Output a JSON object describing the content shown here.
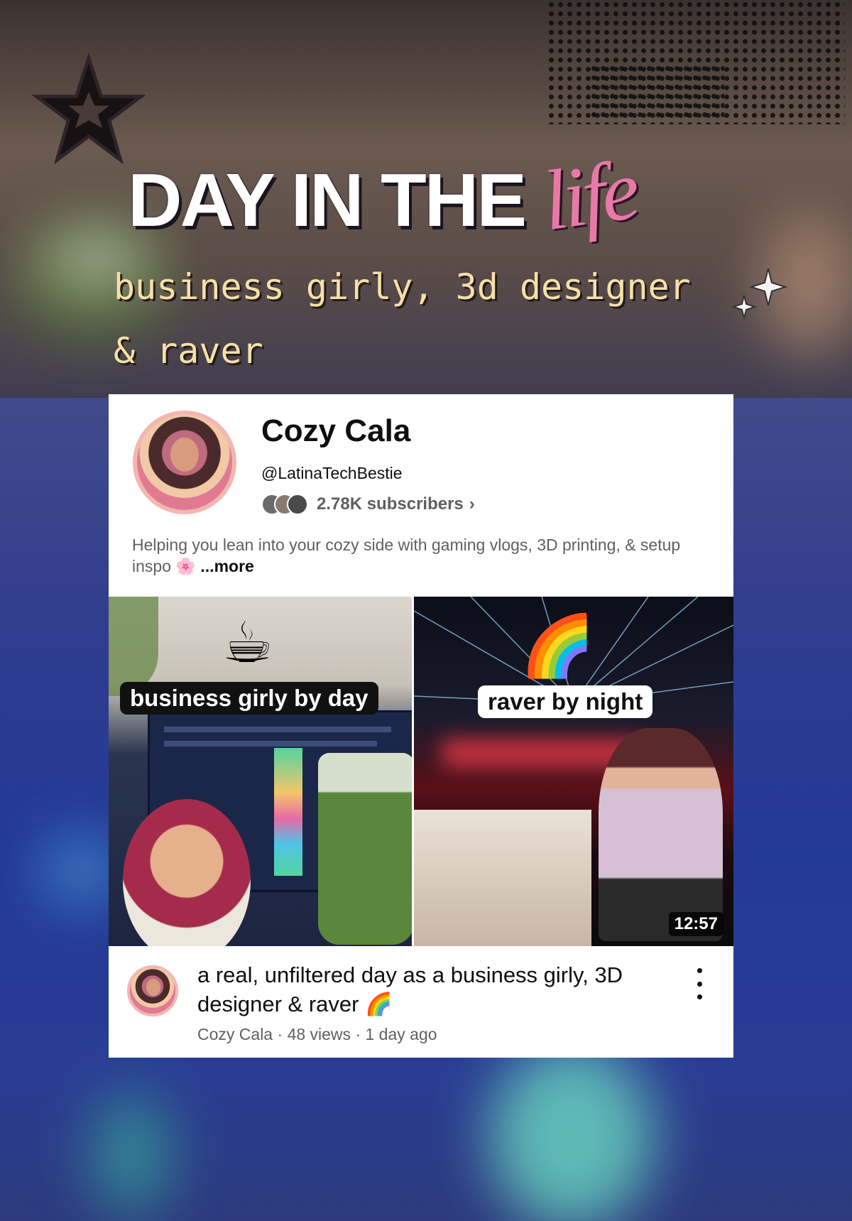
{
  "overlay": {
    "headline_main": "DAY IN THE",
    "headline_script": "life",
    "subtitle_line1": "business girly, 3d designer",
    "subtitle_line2": "& raver"
  },
  "channel": {
    "name": "Cozy Cala",
    "handle": "@LatinaTechBestie",
    "subscribers": "2.78K subscribers",
    "subscribers_chevron": "›",
    "description": "Helping you lean into your cozy side with gaming vlogs, 3D printing, & setup inspo",
    "description_emoji": "🌸",
    "more_label": "...more"
  },
  "video": {
    "thumb_left_label": "business girly by day",
    "thumb_right_label": "raver by night",
    "thumb_left_emoji": "☕",
    "thumb_right_emoji": "🌈",
    "duration": "12:57",
    "title": "a real, unfiltered day as a business girly, 3D designer & raver",
    "title_emoji": "🌈",
    "channel": "Cozy Cala",
    "views": "48 views",
    "age": "1 day ago",
    "separator": "·"
  },
  "colors": {
    "accent_pink": "#e879a7",
    "subtitle_cream": "#f7e0a7",
    "card_bg": "#ffffff",
    "text_primary": "#0f0f0f",
    "text_secondary": "#606060"
  },
  "icons": {
    "star": "star-icon",
    "sparkles": "sparkles-icon",
    "menu": "more-vertical-icon",
    "chevron": "chevron-right-icon"
  }
}
